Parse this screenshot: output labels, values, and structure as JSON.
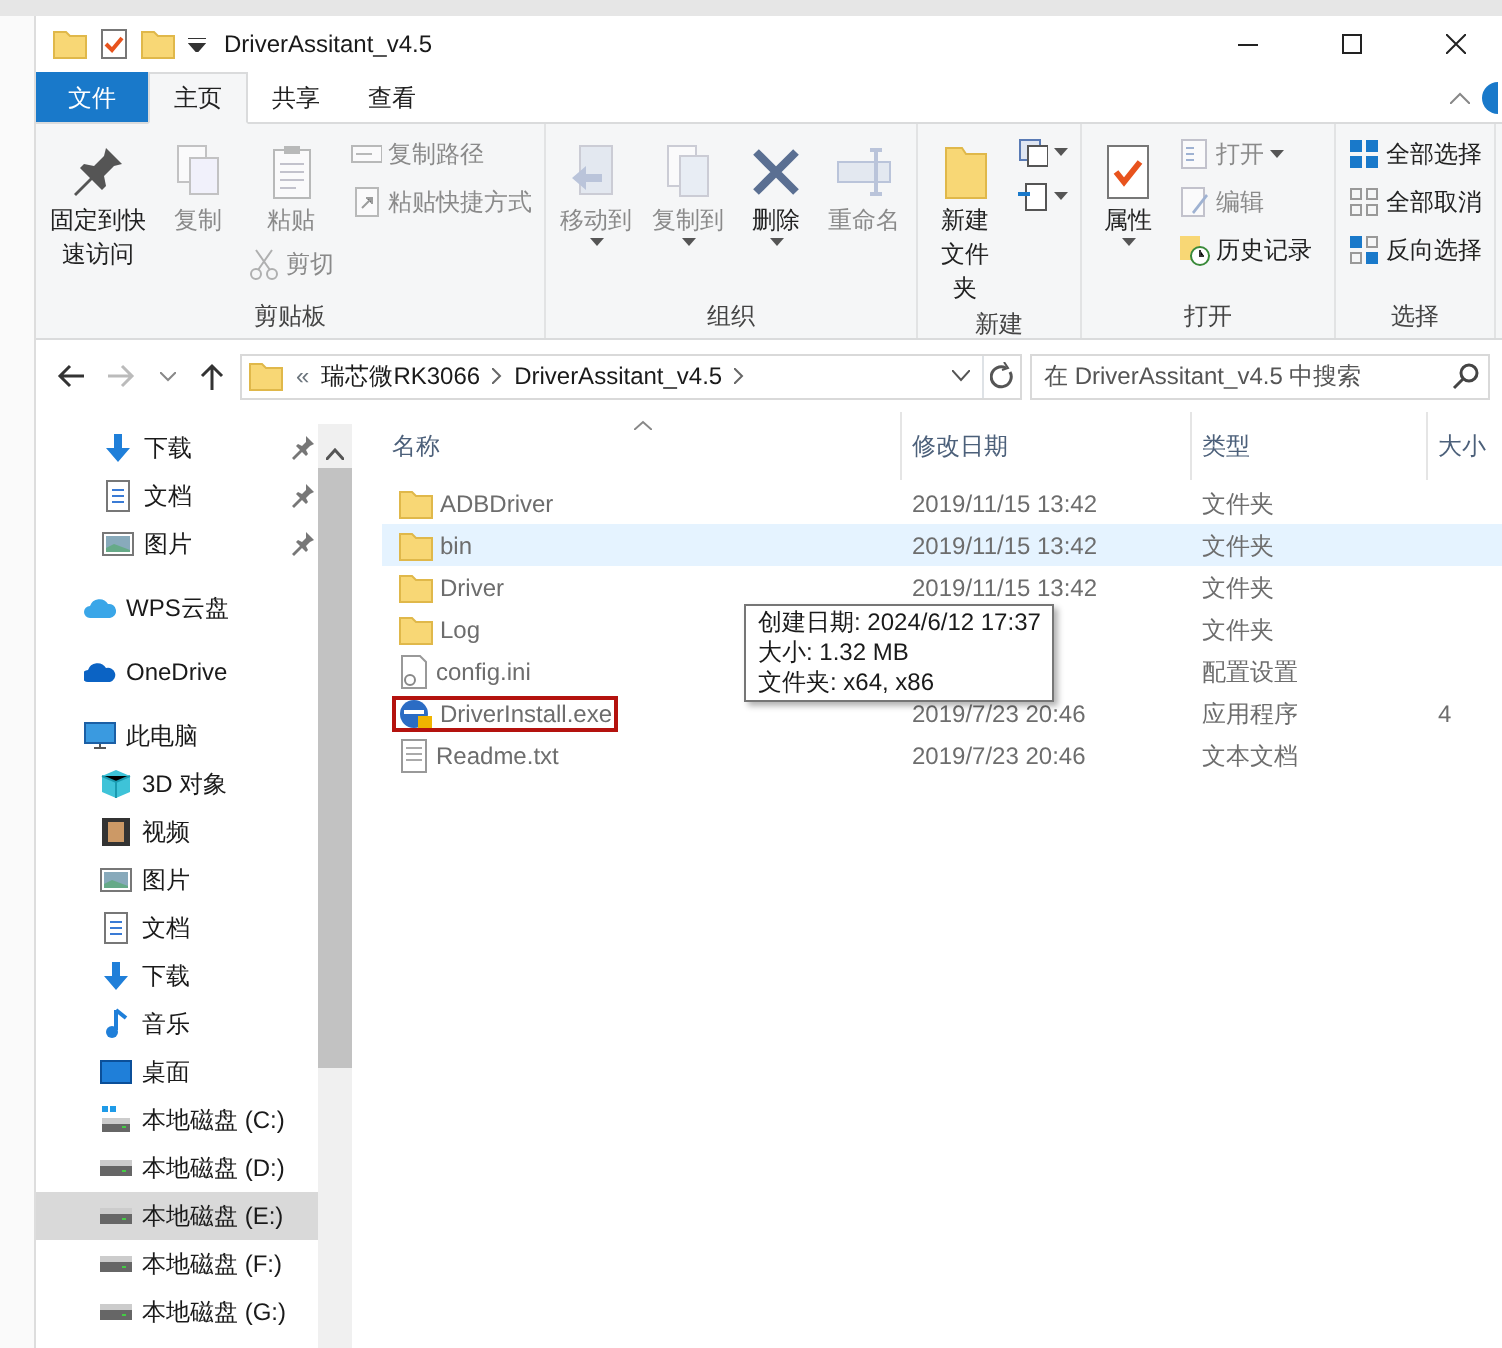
{
  "window": {
    "title": "DriverAssitant_v4.5"
  },
  "ribbon_tabs": [
    {
      "label": "文件",
      "kind": "file",
      "selected": false
    },
    {
      "label": "主页",
      "kind": "tab",
      "selected": true
    },
    {
      "label": "共享",
      "kind": "tab",
      "selected": false
    },
    {
      "label": "查看",
      "kind": "tab",
      "selected": false
    }
  ],
  "ribbon_groups": [
    {
      "label": "剪贴板",
      "columns": [
        [
          {
            "label": "固定到快速访问",
            "kind": "large",
            "disabled": false,
            "dropdown": false
          }
        ],
        [
          {
            "label": "复制",
            "kind": "large",
            "disabled": true,
            "dropdown": false
          }
        ],
        [
          {
            "label": "粘贴",
            "kind": "large",
            "disabled": true,
            "dropdown": false
          },
          {
            "label": "剪切",
            "kind": "small",
            "disabled": true,
            "dropdown": false
          }
        ],
        [
          {
            "label": "复制路径",
            "kind": "small",
            "disabled": true,
            "dropdown": false
          },
          {
            "label": "粘贴快捷方式",
            "kind": "small",
            "disabled": true,
            "dropdown": false
          }
        ]
      ]
    },
    {
      "label": "组织",
      "columns": [
        [
          {
            "label": "移动到",
            "kind": "large",
            "disabled": true,
            "dropdown": true
          }
        ],
        [
          {
            "label": "复制到",
            "kind": "large",
            "disabled": true,
            "dropdown": true
          }
        ],
        [
          {
            "label": "删除",
            "kind": "large",
            "disabled": false,
            "dropdown": true
          }
        ],
        [
          {
            "label": "重命名",
            "kind": "large",
            "disabled": true,
            "dropdown": false
          }
        ]
      ]
    },
    {
      "label": "新建",
      "columns": [
        [
          {
            "label": "新建文件夹",
            "kind": "large",
            "disabled": false,
            "dropdown": false
          }
        ],
        [
          {
            "kind": "small",
            "disabled": false,
            "dropdown": true
          },
          {
            "kind": "small",
            "disabled": false,
            "dropdown": true
          }
        ]
      ]
    },
    {
      "label": "打开",
      "columns": [
        [
          {
            "label": "属性",
            "kind": "large",
            "disabled": false,
            "dropdown": true
          }
        ],
        [
          {
            "label": "打开",
            "kind": "small",
            "disabled": true,
            "dropdown": true
          },
          {
            "label": "编辑",
            "kind": "small",
            "disabled": true,
            "dropdown": false
          },
          {
            "label": "历史记录",
            "kind": "small",
            "disabled": false,
            "dropdown": false
          }
        ]
      ]
    },
    {
      "label": "选择",
      "columns": [
        [
          {
            "label": "全部选择",
            "kind": "small",
            "disabled": false,
            "dropdown": false
          },
          {
            "label": "全部取消",
            "kind": "small",
            "disabled": false,
            "dropdown": false
          },
          {
            "label": "反向选择",
            "kind": "small",
            "disabled": false,
            "dropdown": false
          }
        ]
      ]
    }
  ],
  "address": {
    "overflow": "«",
    "path": [
      "瑞芯微RK3066",
      "DriverAssitant_v4.5"
    ]
  },
  "search": {
    "placeholder": "在 DriverAssitant_v4.5 中搜索"
  },
  "sidebar": {
    "items": [
      {
        "label": "下载",
        "pinned": true,
        "selected": false
      },
      {
        "label": "文档",
        "pinned": true,
        "selected": false
      },
      {
        "label": "图片",
        "pinned": true,
        "selected": false
      },
      {
        "label": "WPS云盘",
        "pinned": false,
        "selected": false
      },
      {
        "label": "OneDrive",
        "pinned": false,
        "selected": false
      },
      {
        "label": "此电脑",
        "pinned": false,
        "selected": false,
        "children": [
          {
            "label": "3D 对象",
            "pinned": false,
            "selected": false
          },
          {
            "label": "视频",
            "pinned": false,
            "selected": false
          },
          {
            "label": "图片",
            "pinned": false,
            "selected": false
          },
          {
            "label": "文档",
            "pinned": false,
            "selected": false
          },
          {
            "label": "下载",
            "pinned": false,
            "selected": false
          },
          {
            "label": "音乐",
            "pinned": false,
            "selected": false
          },
          {
            "label": "桌面",
            "pinned": false,
            "selected": false
          },
          {
            "label": "本地磁盘 (C:)",
            "pinned": false,
            "selected": false
          },
          {
            "label": "本地磁盘 (D:)",
            "pinned": false,
            "selected": false
          },
          {
            "label": "本地磁盘 (E:)",
            "pinned": false,
            "selected": true
          },
          {
            "label": "本地磁盘 (F:)",
            "pinned": false,
            "selected": false
          },
          {
            "label": "本地磁盘 (G:)",
            "pinned": false,
            "selected": false
          }
        ]
      }
    ]
  },
  "table": {
    "columns": [
      {
        "label": "名称",
        "sorted": true
      },
      {
        "label": "修改日期",
        "sorted": false
      },
      {
        "label": "类型",
        "sorted": false
      },
      {
        "label": "大小",
        "sorted": false
      }
    ],
    "rows": [
      {
        "name": "ADBDriver",
        "modified": "2019/11/15 13:42",
        "type": "文件夹",
        "kind": "folder",
        "hovered": false,
        "outlined": false
      },
      {
        "name": "bin",
        "modified": "2019/11/15 13:42",
        "type": "文件夹",
        "kind": "folder",
        "hovered": true,
        "outlined": false
      },
      {
        "name": "Driver",
        "modified": "2019/11/15 13:42",
        "type": "文件夹",
        "kind": "folder",
        "hovered": false,
        "outlined": false
      },
      {
        "name": "Log",
        "type": "文件夹",
        "kind": "folder",
        "hovered": false,
        "outlined": false
      },
      {
        "name": "config.ini",
        "type": "配置设置",
        "kind": "ini",
        "hovered": false,
        "outlined": false
      },
      {
        "name": "DriverInstall.exe",
        "modified": "2019/7/23 20:46",
        "type": "应用程序",
        "size": "4",
        "kind": "exe",
        "hovered": false,
        "outlined": true
      },
      {
        "name": "Readme.txt",
        "modified": "2019/7/23 20:46",
        "type": "文本文档",
        "kind": "txt",
        "hovered": false,
        "outlined": false
      }
    ]
  },
  "tooltip": {
    "lines": [
      "创建日期: 2024/6/12 17:37",
      "大小: 1.32 MB",
      "文件夹: x64, x86"
    ]
  }
}
